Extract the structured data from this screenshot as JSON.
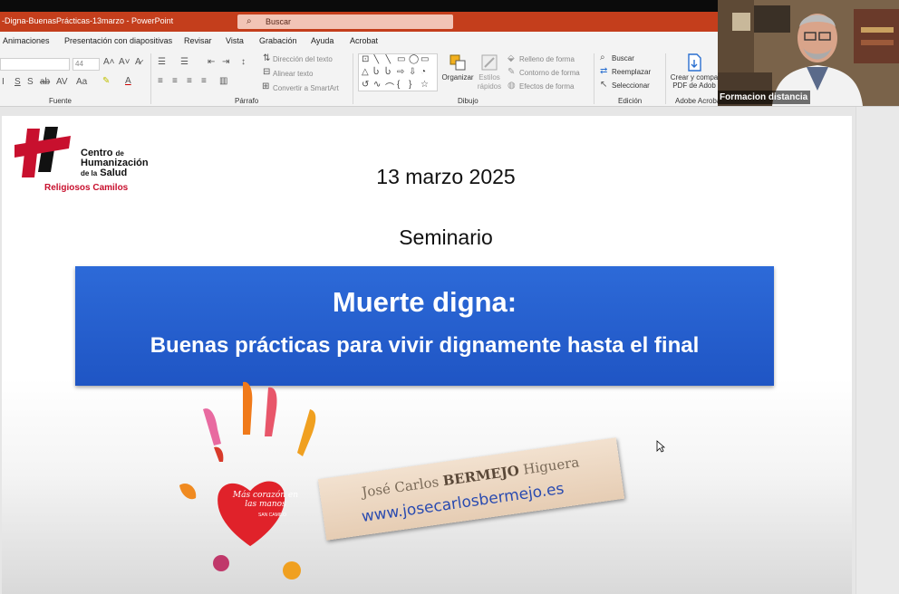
{
  "window": {
    "doc_title": "-Digna-BuenasPrácticas-13marzo - PowerPoint",
    "search_placeholder": "Buscar"
  },
  "ribbon_tabs": [
    "Animaciones",
    "Presentación con diapositivas",
    "Revisar",
    "Vista",
    "Grabación",
    "Ayuda",
    "Acrobat"
  ],
  "ribbon": {
    "font_group": "Fuente",
    "font_size": "44",
    "paragraph_group": "Párrafo",
    "text_direction": "Dirección del texto",
    "align_text": "Alinear texto",
    "convert_smartart": "Convertir a SmartArt",
    "drawing_group": "Dibujo",
    "arrange": "Organizar",
    "quick_styles": "Estilos rápidos",
    "shape_fill": "Relleno de forma",
    "shape_outline": "Contorno de forma",
    "shape_effects": "Efectos de forma",
    "editing_group": "Edición",
    "find": "Buscar",
    "replace": "Reemplazar",
    "select": "Seleccionar",
    "create_pdf": "Crear y compa",
    "create_pdf_line2": "PDF de Adob",
    "adobe_group": "Adobe Acroba"
  },
  "slide": {
    "logo_line1": "Centro",
    "logo_de": "de",
    "logo_line2": "Humanización",
    "logo_line3": "de la",
    "logo_line3b": "Salud",
    "logo_sub": "Religiosos Camilos",
    "date": "13 marzo 2025",
    "subtitle": "Seminario",
    "title": "Muerte digna:",
    "tagline": "Buenas prácticas para vivir dignamente hasta el final",
    "heart_text": "Más corazón en las manos",
    "heart_sign": "SAN CAMILO",
    "author_first": "José Carlos",
    "author_bold": "BERMEJO",
    "author_last": "Higuera",
    "website": "www.josecarlosbermejo.es"
  },
  "webcam": {
    "label": "Formacion distancia"
  },
  "colors": {
    "title_bar": "#c43e1c",
    "banner": "#2560cf",
    "logo_red": "#c8102e"
  }
}
